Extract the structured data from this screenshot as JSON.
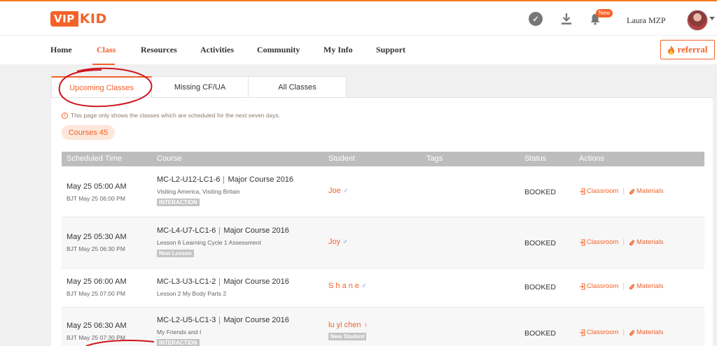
{
  "brand": {
    "logo_left": "VIP",
    "logo_right": "KID"
  },
  "header": {
    "username": "Laura MZP",
    "new_badge": "New",
    "icons": [
      "v-icon",
      "download-icon",
      "bell-icon"
    ]
  },
  "nav": {
    "items": [
      "Home",
      "Class",
      "Resources",
      "Activities",
      "Community",
      "My Info",
      "Support"
    ],
    "active": "Class",
    "referral_label": "referral"
  },
  "tabs": [
    {
      "label": "Upcoming Classes",
      "active": true
    },
    {
      "label": "Missing CF/UA",
      "active": false
    },
    {
      "label": "All Classes",
      "active": false
    }
  ],
  "notice": "This page only shows the classes which are scheduled for the next seven days.",
  "courses_count_label": "Courses 45",
  "table": {
    "headers": [
      "Scheduled Time",
      "Course",
      "Student",
      "Tags",
      "Status",
      "Actions"
    ],
    "rows": [
      {
        "time": "May 25 05:00 AM",
        "bjt": "BJT May 25 06:00 PM",
        "code": "MC-L2-U12-LC1-6",
        "course": "Major Course 2016",
        "lesson": "Visiting America, Visiting Britain",
        "tag": "INTERACTION",
        "student": "Joe",
        "gender": "male",
        "student_tag": "",
        "status": "BOOKED",
        "classroom": "Classroom",
        "materials": "Materials"
      },
      {
        "time": "May 25 05:30 AM",
        "bjt": "BJT May 25 06:30 PM",
        "code": "MC-L4-U7-LC1-6",
        "course": "Major Course 2016",
        "lesson": "Lesson 6 Learning Cycle 1 Assessment",
        "tag": "New Lesson",
        "student": "Joy",
        "gender": "male",
        "student_tag": "",
        "status": "BOOKED",
        "classroom": "Classroom",
        "materials": "Materials"
      },
      {
        "time": "May 25 06:00 AM",
        "bjt": "BJT May 25 07:00 PM",
        "code": "MC-L3-U3-LC1-2",
        "course": "Major Course 2016",
        "lesson": "Lesson 2 My Body Parts 2",
        "tag": "",
        "student": "S h a n e",
        "gender": "male",
        "student_tag": "",
        "status": "BOOKED",
        "classroom": "Classroom",
        "materials": "Materials"
      },
      {
        "time": "May 25 06:30 AM",
        "bjt": "BJT May 25 07:30 PM",
        "code": "MC-L2-U5-LC1-3",
        "course": "Major Course 2016",
        "lesson": "My Friends and I",
        "tag": "INTERACTION",
        "student": "lu yi chen",
        "gender": "female",
        "student_tag": "New Student",
        "status": "BOOKED",
        "classroom": "Classroom",
        "materials": "Materials"
      }
    ]
  },
  "colors": {
    "accent": "#f4622a",
    "annotation": "#d0141e",
    "header_bg": "#bdbdbd"
  }
}
